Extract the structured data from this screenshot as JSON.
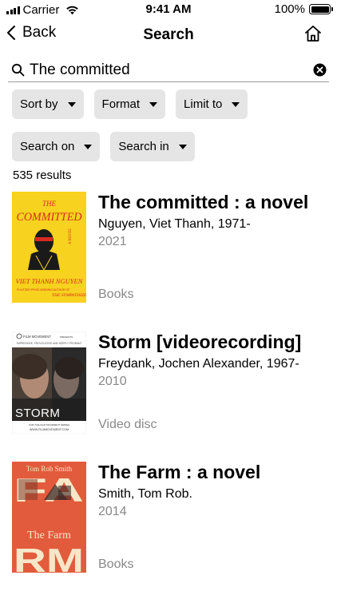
{
  "status_bar": {
    "carrier": "Carrier",
    "time": "9:41 AM",
    "battery": "100%",
    "battery_level": 1.0
  },
  "nav": {
    "back_label": "Back",
    "title": "Search",
    "home_icon": "home-icon"
  },
  "search": {
    "value": "The committed",
    "placeholder": ""
  },
  "filters": [
    {
      "label": "Search on"
    },
    {
      "label": "Format"
    },
    {
      "label": "Limit to"
    },
    {
      "label": "Search on"
    },
    {
      "label": "Search in"
    }
  ],
  "filter_row1": [
    "Sort by",
    "Format",
    "Limit to"
  ],
  "filter_row2": [
    "Search on",
    "Search in"
  ],
  "results_count": "535 results",
  "results": [
    {
      "title": "The committed : a novel",
      "author": "Nguyen, Viet Thanh, 1971-",
      "year": "2021",
      "format": "Books",
      "cover": {
        "title": "THE COMMITTED",
        "subtitle": "A NOVEL",
        "author": "VIET THANH NGUYEN",
        "blurb": "PULITZER PRIZE-WINNING AUTHOR OF",
        "blurb2": "THE SYMPATHIZER",
        "bg": "#f7d21e",
        "fg": "#d72a20"
      }
    },
    {
      "title": "Storm [videorecording]",
      "author": "Freydank, Jochen Alexander, 1967-",
      "year": "2010",
      "format": "Video disc",
      "cover": {
        "studio": "FILM MOVEMENT",
        "studio_suffix": "PRESENTS",
        "tagline": "\"IMPRESSIVE, PROVOCATIVE AND DEEPLY PROBING\"",
        "title": "STORM",
        "footer": "JOIN THE FILM MOVEMENT SERIES",
        "url": "WWW.FILMMOVEMENT.COM"
      }
    },
    {
      "title": "The Farm : a novel",
      "author": "Smith, Tom Rob.",
      "year": "2014",
      "format": "Books",
      "cover": {
        "author": "Tom Rob Smith",
        "title": "The Farm",
        "big_top": "FA",
        "big_bottom": "RM",
        "bg": "#e25b3c"
      }
    }
  ]
}
